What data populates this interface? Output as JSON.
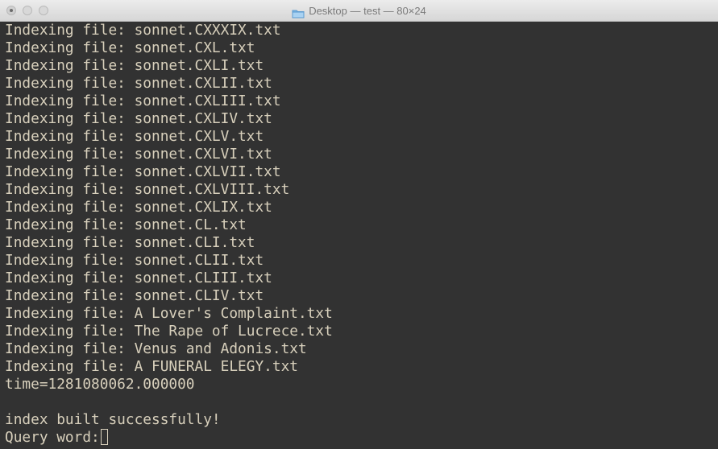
{
  "window": {
    "title": "Desktop — test — 80×24",
    "title_icon": "folder-icon",
    "terminal_bg": "#323232",
    "terminal_fg": "#d8d0bc"
  },
  "terminal": {
    "lines": [
      "Indexing file: sonnet.CXXXIX.txt",
      "Indexing file: sonnet.CXL.txt",
      "Indexing file: sonnet.CXLI.txt",
      "Indexing file: sonnet.CXLII.txt",
      "Indexing file: sonnet.CXLIII.txt",
      "Indexing file: sonnet.CXLIV.txt",
      "Indexing file: sonnet.CXLV.txt",
      "Indexing file: sonnet.CXLVI.txt",
      "Indexing file: sonnet.CXLVII.txt",
      "Indexing file: sonnet.CXLVIII.txt",
      "Indexing file: sonnet.CXLIX.txt",
      "Indexing file: sonnet.CL.txt",
      "Indexing file: sonnet.CLI.txt",
      "Indexing file: sonnet.CLII.txt",
      "Indexing file: sonnet.CLIII.txt",
      "Indexing file: sonnet.CLIV.txt",
      "Indexing file: A Lover's Complaint.txt",
      "Indexing file: The Rape of Lucrece.txt",
      "Indexing file: Venus and Adonis.txt",
      "Indexing file: A FUNERAL ELEGY.txt",
      "time=1281080062.000000",
      "",
      "index built successfully!"
    ],
    "prompt": "Query word:"
  }
}
